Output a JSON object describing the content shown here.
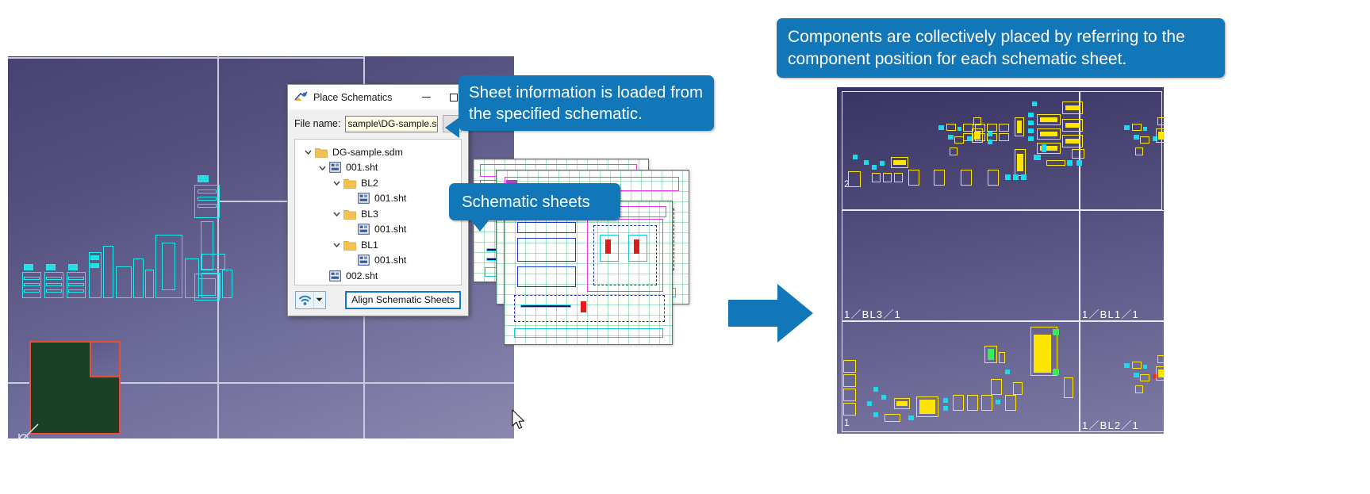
{
  "dialog": {
    "title": "Place Schematics",
    "app_icon": "schematic-app-icon",
    "minimize_label": "minimize",
    "maximize_label": "maximize",
    "file_name_label": "File name:",
    "file_name_value": "sample\\DG-sample.sdm",
    "file_name_placeholder": "",
    "browse_label": "",
    "tree": [
      {
        "label": "DG-sample.sdm",
        "indent": 1,
        "icon": "folder-icon",
        "expanded": true,
        "chevron": true
      },
      {
        "label": "001.sht",
        "indent": 2,
        "icon": "sheet-icon",
        "expanded": true,
        "chevron": true
      },
      {
        "label": "BL2",
        "indent": 3,
        "icon": "folder-icon",
        "expanded": true,
        "chevron": true
      },
      {
        "label": "001.sht",
        "indent": 4,
        "icon": "sheet-icon",
        "expanded": false,
        "chevron": false
      },
      {
        "label": "BL3",
        "indent": 3,
        "icon": "folder-icon",
        "expanded": true,
        "chevron": true
      },
      {
        "label": "001.sht",
        "indent": 4,
        "icon": "sheet-icon",
        "expanded": false,
        "chevron": false
      },
      {
        "label": "BL1",
        "indent": 3,
        "icon": "folder-icon",
        "expanded": true,
        "chevron": true
      },
      {
        "label": "001.sht",
        "indent": 4,
        "icon": "sheet-icon",
        "expanded": false,
        "chevron": false
      },
      {
        "label": "002.sht",
        "indent": 2,
        "icon": "sheet-icon",
        "expanded": false,
        "chevron": false
      }
    ],
    "footer": {
      "wifi_icon": "wifi-icon",
      "dropdown_caret": "chevron-down-icon",
      "align_button_label": "Align Schematic Sheets"
    }
  },
  "callouts": {
    "sheet_info": "Sheet information is loaded from the specified schematic.",
    "schematic_sheets": "Schematic sheets",
    "components": "Components are collectively placed by referring to the component position for each schematic sheet."
  },
  "board_view": {
    "labels": {
      "top_left_quadrant": "2",
      "mid_left_quadrant": "1／BL3／1",
      "mid_right_quadrant": "1／BL1／1",
      "bottom_left_quadrant": "1",
      "bottom_right_quadrant": "1／BL2／1"
    }
  },
  "colors": {
    "callout_blue": "#1277b8",
    "arrow_blue": "#1277b8",
    "cad_cyan": "#18dcee",
    "pad_yellow": "#ffe600",
    "board_green": "#1c4026",
    "board_outline_red": "#ee4b3a",
    "accent_button_border": "#0f7ac0"
  }
}
